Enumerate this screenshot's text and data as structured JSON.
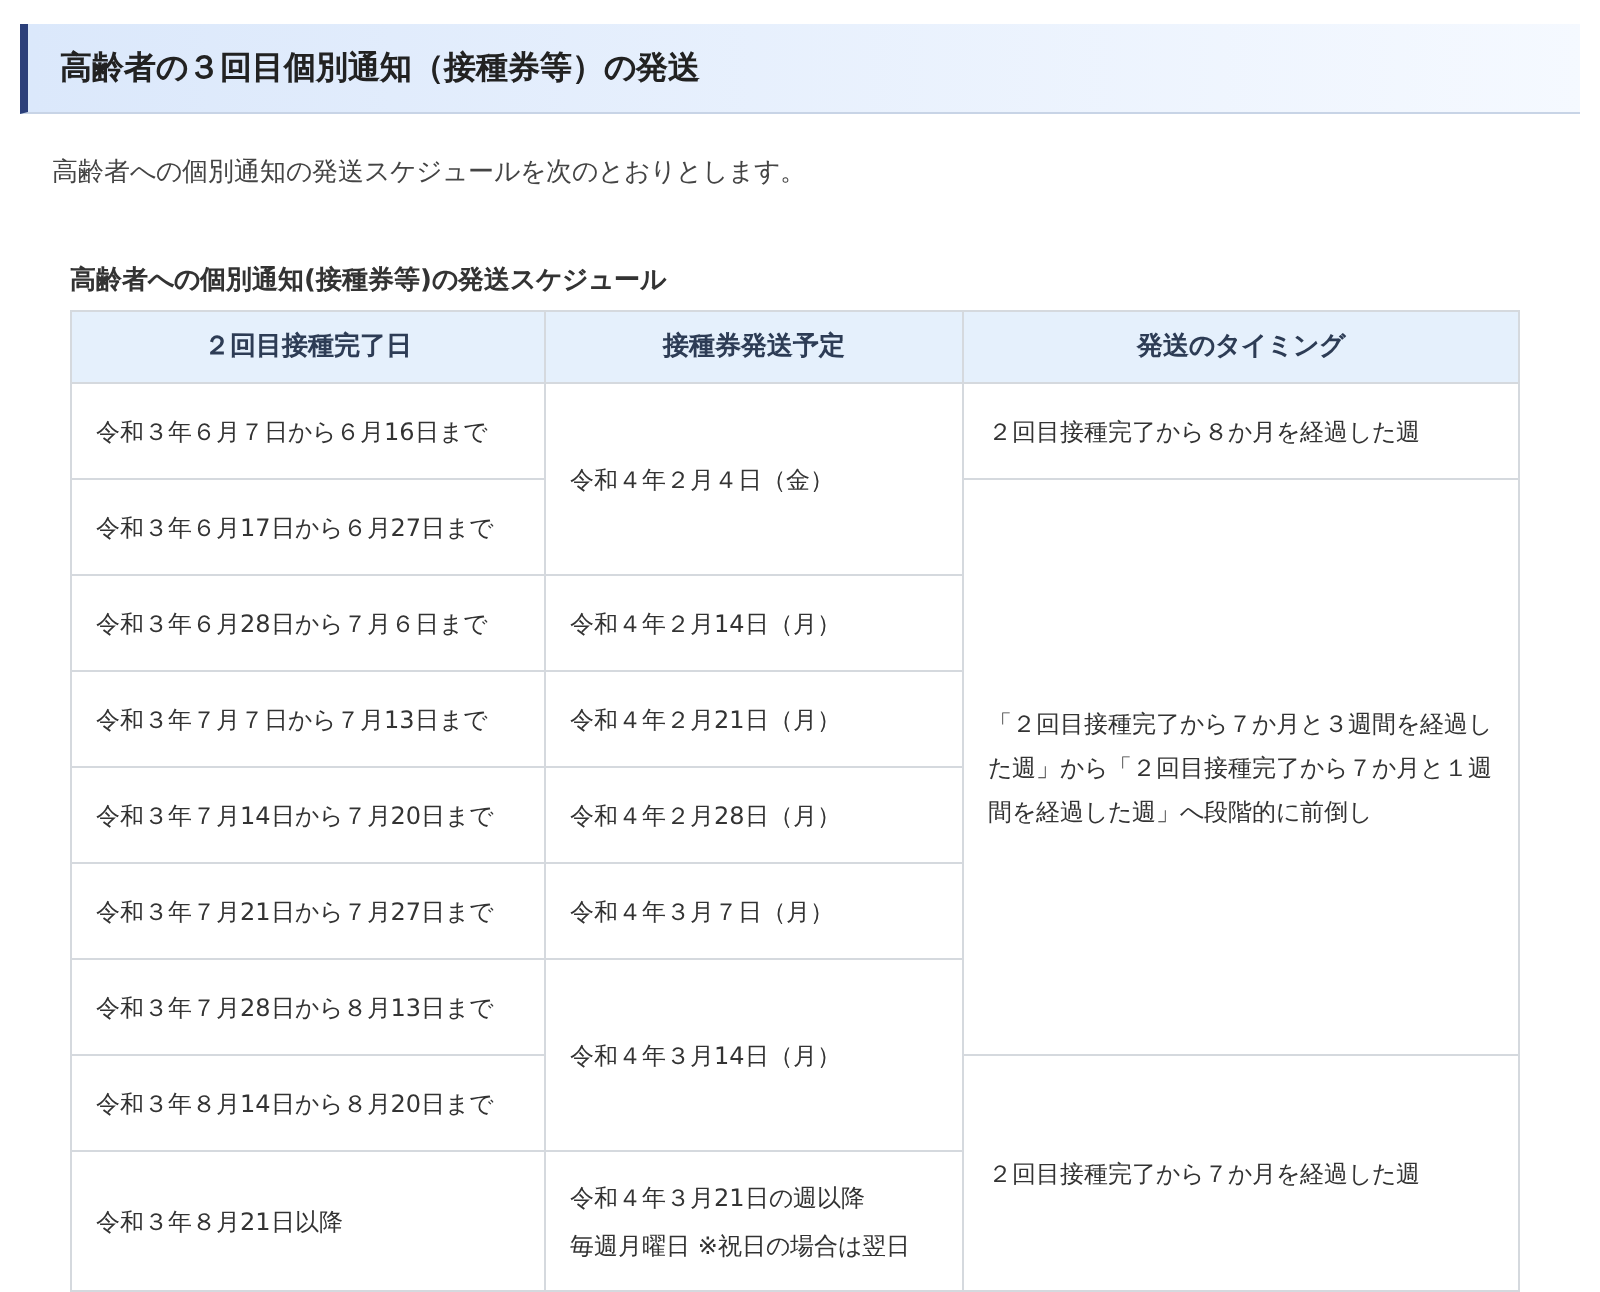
{
  "heading": "高齢者の３回目個別通知（接種券等）の発送",
  "intro": "高齢者への個別通知の発送スケジュールを次のとおりとします。",
  "table": {
    "caption": "高齢者への個別通知(接種券等)の発送スケジュール",
    "columns": [
      "２回目接種完了日",
      "接種券発送予定",
      "発送のタイミング"
    ],
    "rows": [
      {
        "completed": "令和３年６月７日から６月16日まで",
        "ship": "令和４年２月４日（金）",
        "timing": "２回目接種完了から８か月を経過した週"
      },
      {
        "completed": "令和３年６月17日から６月27日まで",
        "timing": "「２回目接種完了から７か月と３週間を経過した週」から「２回目接種完了から７か月と１週間を経過した週」へ段階的に前倒し"
      },
      {
        "completed": "令和３年６月28日から７月６日まで",
        "ship": "令和４年２月14日（月）"
      },
      {
        "completed": "令和３年７月７日から７月13日まで",
        "ship": "令和４年２月21日（月）"
      },
      {
        "completed": "令和３年７月14日から７月20日まで",
        "ship": "令和４年２月28日（月）"
      },
      {
        "completed": "令和３年７月21日から７月27日まで",
        "ship": "令和４年３月７日（月）"
      },
      {
        "completed": "令和３年７月28日から８月13日まで",
        "ship": "令和４年３月14日（月）"
      },
      {
        "completed": "令和３年８月14日から８月20日まで",
        "timing": "２回目接種完了から７か月を経過した週"
      },
      {
        "completed": "令和３年８月21日以降",
        "ship": "令和４年３月21日の週以降",
        "ship_note": "毎週月曜日 ※祝日の場合は翌日"
      }
    ]
  }
}
